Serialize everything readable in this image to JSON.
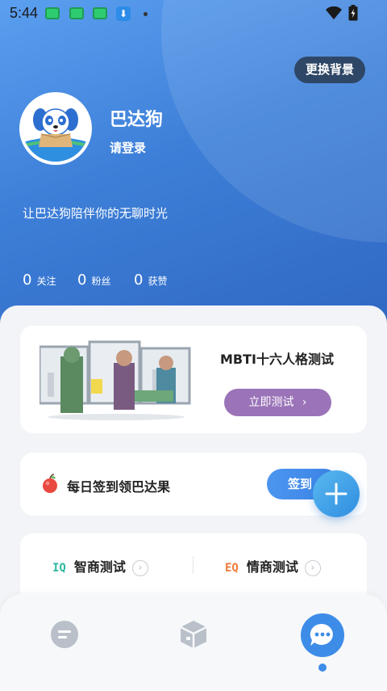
{
  "status_bar": {
    "time": "5:44"
  },
  "header": {
    "change_bg_label": "更换背景",
    "username": "巴达狗",
    "login_label": "请登录",
    "slogan": "让巴达狗陪伴你的无聊时光",
    "stats": [
      {
        "num": "0",
        "label": "关注"
      },
      {
        "num": "0",
        "label": "粉丝"
      },
      {
        "num": "0",
        "label": "获赞"
      }
    ]
  },
  "mbti": {
    "title": "MBTI十六人格测试",
    "button": "立即测试"
  },
  "checkin": {
    "text": "每日签到领巴达果",
    "button": "签到"
  },
  "tests": [
    {
      "badge": "IQ",
      "label": "智商测试",
      "color": "#2fb8a0"
    },
    {
      "badge": "EQ",
      "label": "情商测试",
      "color": "#f07b3a"
    }
  ],
  "colors": {
    "header": "#3d7fd8",
    "accent": "#3d8ce8",
    "mbti_button": "#9a73b8"
  },
  "tabbar": {
    "icons": [
      "list-icon",
      "box-icon",
      "chat-bubble-icon"
    ],
    "active": 2
  }
}
